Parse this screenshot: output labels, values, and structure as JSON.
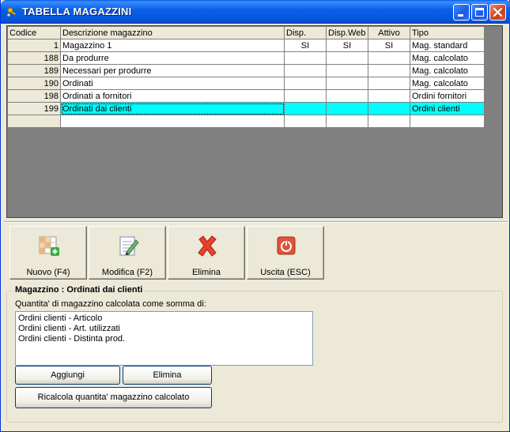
{
  "window": {
    "title": "TABELLA MAGAZZINI"
  },
  "grid": {
    "headers": [
      "Codice",
      "Descrizione magazzino",
      "Disp.",
      "Disp.Web",
      "Attivo",
      "Tipo"
    ],
    "rows": [
      {
        "codice": "1",
        "descrizione": "Magazzino 1",
        "disp": "SI",
        "dispweb": "SI",
        "attivo": "SI",
        "tipo": "Mag. standard"
      },
      {
        "codice": "188",
        "descrizione": "Da produrre",
        "disp": "",
        "dispweb": "",
        "attivo": "",
        "tipo": "Mag. calcolato"
      },
      {
        "codice": "189",
        "descrizione": "Necessari per produrre",
        "disp": "",
        "dispweb": "",
        "attivo": "",
        "tipo": "Mag. calcolato"
      },
      {
        "codice": "190",
        "descrizione": "Ordinati",
        "disp": "",
        "dispweb": "",
        "attivo": "",
        "tipo": "Mag. calcolato"
      },
      {
        "codice": "198",
        "descrizione": "Ordinati a fornitori",
        "disp": "",
        "dispweb": "",
        "attivo": "",
        "tipo": "Ordini fornitori"
      },
      {
        "codice": "199",
        "descrizione": "Ordinati dai clienti",
        "disp": "",
        "dispweb": "",
        "attivo": "",
        "tipo": "Ordini clienti"
      }
    ],
    "selected_row": 5,
    "selection_color": "#00FFFF"
  },
  "toolbar": {
    "new_label": "Nuovo (F4)",
    "edit_label": "Modifica (F2)",
    "delete_label": "Elimina",
    "exit_label": "Uscita (ESC)",
    "icons": [
      "grid-add-icon",
      "edit-document-icon",
      "red-x-icon",
      "power-icon"
    ]
  },
  "detail": {
    "group_title": "Magazzino : Ordinati dai clienti",
    "sum_label": "Quantita' di magazzino calcolata come somma di:",
    "items": [
      "Ordini clienti - Articolo",
      "Ordini clienti - Art. utilizzati",
      "Ordini clienti - Distinta prod."
    ],
    "add_label": "Aggiungi",
    "remove_label": "Elimina",
    "recalc_label": "Ricalcola quantita' magazzino calcolato"
  }
}
